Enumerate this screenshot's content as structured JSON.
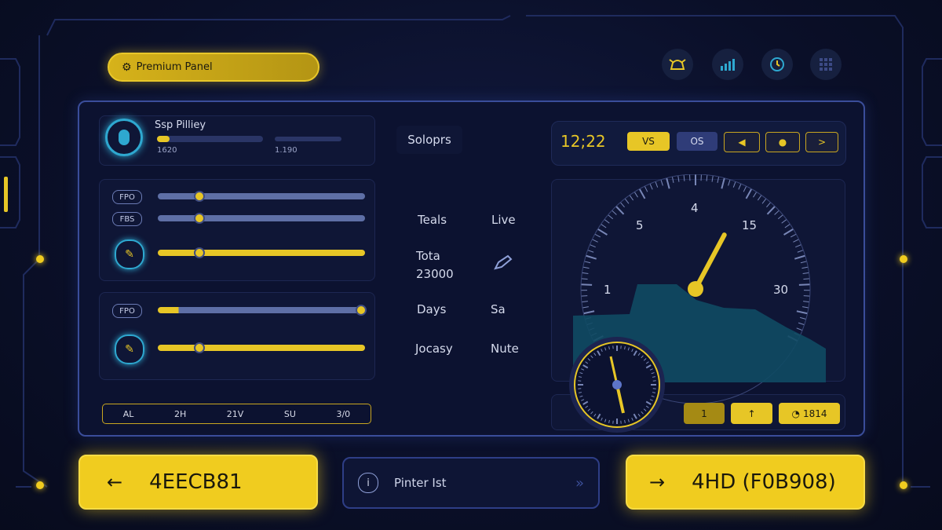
{
  "header": {
    "premium_label": "Premium Panel",
    "icons": [
      "alarm-icon",
      "signal-chart-icon",
      "refresh-clock-icon",
      "grid-icon"
    ]
  },
  "profile": {
    "name": "Ssp Pilliey",
    "stat1": "1620",
    "stat2": "1.190",
    "progress": 0.12
  },
  "sliders_group1": [
    {
      "label": "FPO",
      "value": 0.2
    },
    {
      "label": "FBS",
      "value": 0.2
    },
    {
      "label": "",
      "value": 0.2
    }
  ],
  "sliders_group2": [
    {
      "label": "FPO",
      "value": 0.98
    },
    {
      "label": "",
      "value": 0.2
    }
  ],
  "tabs": [
    "AL",
    "2H",
    "21V",
    "SU",
    "3/0"
  ],
  "center": {
    "title": "Soloprs",
    "rows": [
      {
        "left": "Teals",
        "right": "Live"
      },
      {
        "left": "Tota\n23000",
        "right": ""
      },
      {
        "left": "Days",
        "right": "Sa"
      },
      {
        "left": "Jocasy",
        "right": "Nute"
      }
    ]
  },
  "controls": {
    "time": "12;22",
    "vs_label": "VS",
    "os_label": "OS"
  },
  "gauge": {
    "labels": [
      "1",
      "5",
      "4",
      "15",
      "30"
    ],
    "needle_value": 0.62
  },
  "bottom_buttons": {
    "b1": "1",
    "b3": "1814"
  },
  "footer": {
    "left_value": "4EECB81",
    "middle_label": "Pinter Ist",
    "right_value": "4HD (F0B908)"
  },
  "colors": {
    "accent": "#f0cc1f",
    "panel_border": "#3a4d9a",
    "background": "#0a0f28",
    "cyan": "#2ea8d0"
  }
}
